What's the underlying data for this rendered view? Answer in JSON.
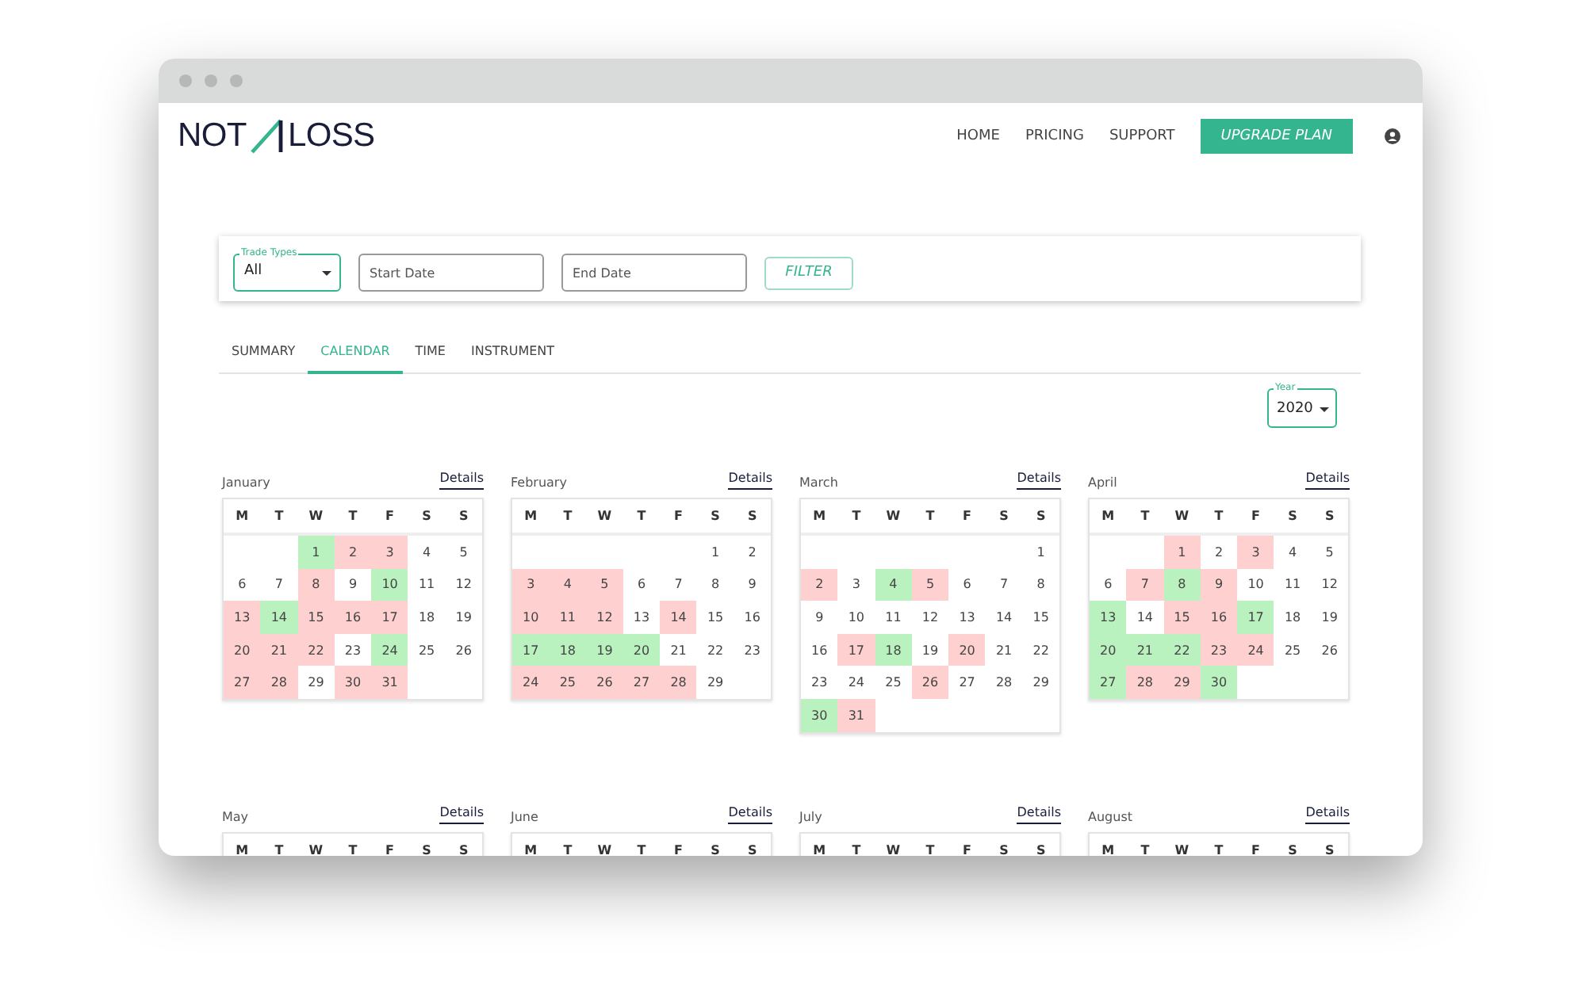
{
  "logo": {
    "left": "NOT",
    "right": "LOSS"
  },
  "nav": [
    {
      "label": "HOME",
      "kind": "link"
    },
    {
      "label": "PRICING",
      "kind": "link"
    },
    {
      "label": "SUPPORT",
      "kind": "link"
    },
    {
      "label": "UPGRADE PLAN",
      "kind": "button"
    }
  ],
  "filters": {
    "trade_types": {
      "label": "Trade Types",
      "value": "All"
    },
    "start_date": {
      "placeholder": "Start Date"
    },
    "end_date": {
      "placeholder": "End Date"
    },
    "button": "FILTER"
  },
  "tabs": [
    {
      "label": "SUMMARY",
      "selected": false
    },
    {
      "label": "CALENDAR",
      "selected": true
    },
    {
      "label": "TIME",
      "selected": false
    },
    {
      "label": "INSTRUMENT",
      "selected": false
    }
  ],
  "year": {
    "label": "Year",
    "value": "2020"
  },
  "months": [
    {
      "name": "January",
      "details": "Details",
      "weekdays": [
        "M",
        "T",
        "W",
        "T",
        "F",
        "S",
        "S"
      ],
      "weeks": [
        [
          {
            "d": "1",
            "color": "#b9f2be"
          },
          {
            "d": "2",
            "color": "#ffd0d0"
          },
          {
            "d": "3",
            "color": "#ffd0d0"
          },
          {
            "d": "4"
          },
          {
            "d": "5"
          }
        ],
        [
          {
            "d": "6"
          },
          {
            "d": "7"
          },
          {
            "d": "8",
            "color": "#ffd0d0"
          },
          {
            "d": "9"
          },
          {
            "d": "10",
            "color": "#b9f2be"
          },
          {
            "d": "11"
          },
          {
            "d": "12"
          }
        ],
        [
          {
            "d": "13",
            "color": "#ffd0d0"
          },
          {
            "d": "14",
            "color": "#b9f2be"
          },
          {
            "d": "15",
            "color": "#ffd0d0"
          },
          {
            "d": "16",
            "color": "#ffd0d0"
          },
          {
            "d": "17",
            "color": "#ffd0d0"
          },
          {
            "d": "18"
          },
          {
            "d": "19"
          }
        ],
        [
          {
            "d": "20",
            "color": "#ffd0d0"
          },
          {
            "d": "21",
            "color": "#ffd0d0"
          },
          {
            "d": "22",
            "color": "#ffd0d0"
          },
          {
            "d": "23"
          },
          {
            "d": "24",
            "color": "#b9f2be"
          },
          {
            "d": "25"
          },
          {
            "d": "26"
          }
        ],
        [
          {
            "d": "27",
            "color": "#ffd0d0"
          },
          {
            "d": "28",
            "color": "#ffd0d0"
          },
          {
            "d": "29"
          },
          {
            "d": "30",
            "color": "#ffd0d0"
          },
          {
            "d": "31",
            "color": "#ffd0d0"
          }
        ]
      ]
    },
    {
      "name": "February",
      "details": "Details",
      "weekdays": [
        "M",
        "T",
        "W",
        "T",
        "F",
        "S",
        "S"
      ],
      "weeks": [
        [
          {
            "d": "1"
          },
          {
            "d": "2"
          }
        ],
        [
          {
            "d": "3",
            "color": "#ffd0d0"
          },
          {
            "d": "4",
            "color": "#ffd0d0"
          },
          {
            "d": "5",
            "color": "#ffd0d0"
          },
          {
            "d": "6"
          },
          {
            "d": "7"
          },
          {
            "d": "8"
          },
          {
            "d": "9"
          }
        ],
        [
          {
            "d": "10",
            "color": "#ffd0d0"
          },
          {
            "d": "11",
            "color": "#ffd0d0"
          },
          {
            "d": "12",
            "color": "#ffd0d0"
          },
          {
            "d": "13"
          },
          {
            "d": "14",
            "color": "#ffd0d0"
          },
          {
            "d": "15"
          },
          {
            "d": "16"
          }
        ],
        [
          {
            "d": "17",
            "color": "#b9f2be"
          },
          {
            "d": "18",
            "color": "#b9f2be"
          },
          {
            "d": "19",
            "color": "#b9f2be"
          },
          {
            "d": "20",
            "color": "#b9f2be"
          },
          {
            "d": "21"
          },
          {
            "d": "22"
          },
          {
            "d": "23"
          }
        ],
        [
          {
            "d": "24",
            "color": "#ffd0d0"
          },
          {
            "d": "25",
            "color": "#ffd0d0"
          },
          {
            "d": "26",
            "color": "#ffd0d0"
          },
          {
            "d": "27",
            "color": "#ffd0d0"
          },
          {
            "d": "28",
            "color": "#ffd0d0"
          },
          {
            "d": "29"
          }
        ]
      ]
    },
    {
      "name": "March",
      "details": "Details",
      "weekdays": [
        "M",
        "T",
        "W",
        "T",
        "F",
        "S",
        "S"
      ],
      "weeks": [
        [
          {
            "d": "1"
          }
        ],
        [
          {
            "d": "2",
            "color": "#ffd0d0"
          },
          {
            "d": "3"
          },
          {
            "d": "4",
            "color": "#b9f2be"
          },
          {
            "d": "5",
            "color": "#ffd0d0"
          },
          {
            "d": "6"
          },
          {
            "d": "7"
          },
          {
            "d": "8"
          }
        ],
        [
          {
            "d": "9"
          },
          {
            "d": "10"
          },
          {
            "d": "11"
          },
          {
            "d": "12"
          },
          {
            "d": "13"
          },
          {
            "d": "14"
          },
          {
            "d": "15"
          }
        ],
        [
          {
            "d": "16"
          },
          {
            "d": "17",
            "color": "#ffd0d0"
          },
          {
            "d": "18",
            "color": "#b9f2be"
          },
          {
            "d": "19"
          },
          {
            "d": "20",
            "color": "#ffd0d0"
          },
          {
            "d": "21"
          },
          {
            "d": "22"
          }
        ],
        [
          {
            "d": "23"
          },
          {
            "d": "24"
          },
          {
            "d": "25"
          },
          {
            "d": "26",
            "color": "#ffd0d0"
          },
          {
            "d": "27"
          },
          {
            "d": "28"
          },
          {
            "d": "29"
          }
        ],
        [
          {
            "d": "30",
            "color": "#b9f2be"
          },
          {
            "d": "31",
            "color": "#ffd0d0"
          }
        ]
      ]
    },
    {
      "name": "April",
      "details": "Details",
      "weekdays": [
        "M",
        "T",
        "W",
        "T",
        "F",
        "S",
        "S"
      ],
      "weeks": [
        [
          {
            "d": "1",
            "color": "#ffd0d0"
          },
          {
            "d": "2"
          },
          {
            "d": "3",
            "color": "#ffd0d0"
          },
          {
            "d": "4"
          },
          {
            "d": "5"
          }
        ],
        [
          {
            "d": "6"
          },
          {
            "d": "7",
            "color": "#ffd0d0"
          },
          {
            "d": "8",
            "color": "#b9f2be"
          },
          {
            "d": "9",
            "color": "#ffd0d0"
          },
          {
            "d": "10"
          },
          {
            "d": "11"
          },
          {
            "d": "12"
          }
        ],
        [
          {
            "d": "13",
            "color": "#b9f2be"
          },
          {
            "d": "14"
          },
          {
            "d": "15",
            "color": "#ffd0d0"
          },
          {
            "d": "16",
            "color": "#ffd0d0"
          },
          {
            "d": "17",
            "color": "#b9f2be"
          },
          {
            "d": "18"
          },
          {
            "d": "19"
          }
        ],
        [
          {
            "d": "20",
            "color": "#b9f2be"
          },
          {
            "d": "21",
            "color": "#b9f2be"
          },
          {
            "d": "22",
            "color": "#b9f2be"
          },
          {
            "d": "23",
            "color": "#ffd0d0"
          },
          {
            "d": "24",
            "color": "#ffd0d0"
          },
          {
            "d": "25"
          },
          {
            "d": "26"
          }
        ],
        [
          {
            "d": "27",
            "color": "#b9f2be"
          },
          {
            "d": "28",
            "color": "#ffd0d0"
          },
          {
            "d": "29",
            "color": "#ffd0d0"
          },
          {
            "d": "30",
            "color": "#b9f2be"
          }
        ]
      ]
    },
    {
      "name": "May",
      "details": "Details",
      "weekdays": [
        "M",
        "T",
        "W",
        "T",
        "F",
        "S",
        "S"
      ]
    },
    {
      "name": "June",
      "details": "Details",
      "weekdays": [
        "M",
        "T",
        "W",
        "T",
        "F",
        "S",
        "S"
      ]
    },
    {
      "name": "July",
      "details": "Details",
      "weekdays": [
        "M",
        "T",
        "W",
        "T",
        "F",
        "S",
        "S"
      ]
    },
    {
      "name": "August",
      "details": "Details",
      "weekdays": [
        "M",
        "T",
        "W",
        "T",
        "F",
        "S",
        "S"
      ]
    }
  ]
}
